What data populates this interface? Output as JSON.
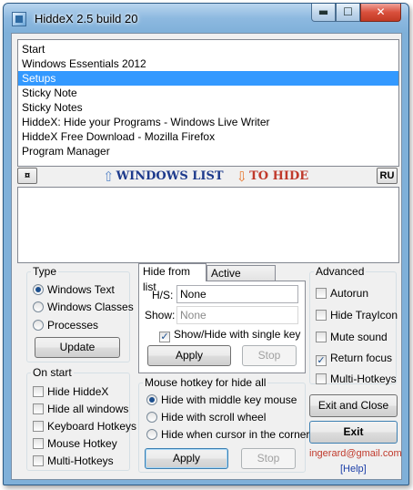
{
  "window": {
    "title": "HiddeX 2.5 build 20",
    "minimize_glyph": "▬",
    "maximize_glyph": "☐",
    "close_glyph": "✕"
  },
  "windows_list": {
    "items": [
      "Start",
      "Windows Essentials 2012",
      "Setups",
      "Sticky Note",
      "Sticky Notes",
      "HiddeX: Hide your Programs - Windows Live Writer",
      "HiddeX Free Download - Mozilla Firefox",
      "Program Manager"
    ],
    "selected_index": 2
  },
  "middle_bar": {
    "swap_button": "¤",
    "windows_list_label": "WINDOWS LIST",
    "to_hide_label": "TO HIDE",
    "language_button": "RU"
  },
  "type_group": {
    "title": "Type",
    "options": [
      "Windows Text",
      "Windows Classes",
      "Processes"
    ],
    "selected_index": 0,
    "update_button": "Update"
  },
  "on_start_group": {
    "title": "On start",
    "options": [
      "Hide HiddeX",
      "Hide all windows",
      "Keyboard Hotkeys",
      "Mouse Hotkey",
      "Multi-Hotkeys"
    ],
    "checked": [
      false,
      false,
      false,
      false,
      false
    ]
  },
  "tabs": {
    "items": [
      "Hide from list",
      "Active window"
    ],
    "active_index": 0
  },
  "hide_from_list": {
    "hs_label": "H/S:",
    "hs_value": "None",
    "show_label": "Show:",
    "show_value": "None",
    "single_key_label": "Show/Hide with single key",
    "single_key_checked": true,
    "apply_button": "Apply",
    "stop_button": "Stop"
  },
  "mouse_hotkey_group": {
    "title": "Mouse hotkey for hide all",
    "options": [
      "Hide with middle key mouse",
      "Hide with scroll wheel",
      "Hide when cursor in the corner"
    ],
    "selected_index": 0,
    "apply_button": "Apply",
    "stop_button": "Stop"
  },
  "advanced_group": {
    "title": "Advanced",
    "options": [
      "Autorun",
      "Hide TrayIcon",
      "Mute sound",
      "Return focus",
      "Multi-Hotkeys"
    ],
    "checked": [
      false,
      false,
      false,
      true,
      false
    ]
  },
  "actions": {
    "exit_and_close": "Exit and Close",
    "exit": "Exit",
    "email": "ingerard@gmail.com",
    "help": "[Help]"
  },
  "colors": {
    "selection": "#3399ff",
    "brand_blue": "#1d3a8c",
    "brand_red": "#c0392b"
  }
}
